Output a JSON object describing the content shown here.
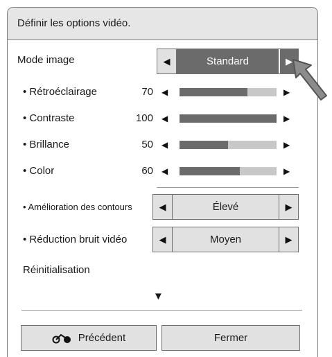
{
  "panel": {
    "title": "Définir les options vidéo."
  },
  "mode_image": {
    "label": "Mode image",
    "value": "Standard"
  },
  "sliders": [
    {
      "label": "• Rétroéclairage",
      "value": "70",
      "level": 0.7
    },
    {
      "label": "• Contraste",
      "value": "100",
      "level": 1.0
    },
    {
      "label": "• Brillance",
      "value": "50",
      "level": 0.5
    },
    {
      "label": "• Color",
      "value": "60",
      "level": 0.62
    }
  ],
  "edge_enhancement": {
    "label": "• Amélioration des contours",
    "value": "Élevé"
  },
  "noise_reduction": {
    "label": "• Réduction bruit vidéo",
    "value": "Moyen"
  },
  "reset": {
    "label": "Réinitialisation"
  },
  "footer": {
    "previous_label": "Précédent",
    "close_label": "Fermer"
  },
  "colors": {
    "header_bg": "#e6e6e6",
    "active_bg": "#6b6b6b",
    "track_bg": "#c8c8c8",
    "control_bg": "#e1e1e1"
  }
}
